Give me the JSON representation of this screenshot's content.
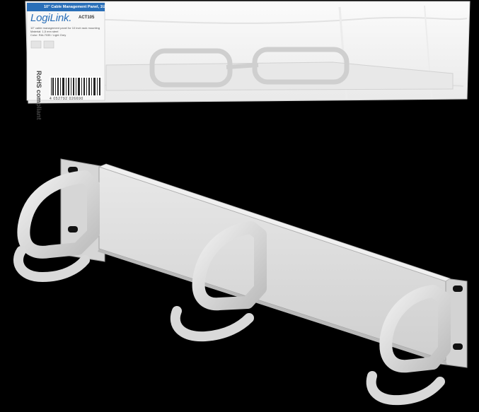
{
  "image": {
    "background": "#000000",
    "product_color": "#dcdcdc"
  },
  "label": {
    "title": "10\" Cable Management Panel, 1U",
    "brand": "LogiLink.",
    "model": "ACT105",
    "desc_1": "10\" cable management panel for 10 inch rack mounting",
    "desc_2": "Material: 1,5 mm steel",
    "desc_3": "Color: RAL7035 / Light Grey",
    "barcode_number": "4 052792 026690",
    "rohs": "RoHS compliant"
  }
}
